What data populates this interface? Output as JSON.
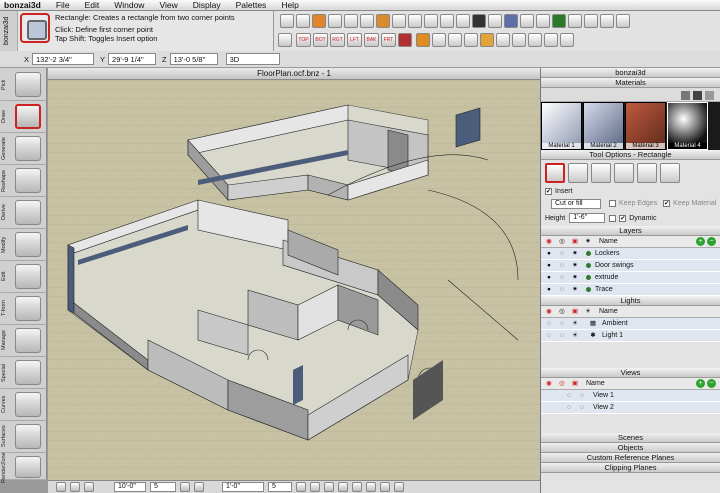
{
  "menu": {
    "app": "bonzai3d",
    "items": [
      "File",
      "Edit",
      "Window",
      "View",
      "Display",
      "Palettes",
      "Help"
    ]
  },
  "hint": {
    "side_label": "bonzai3d",
    "line1": "Rectangle:  Creates a rectangle from two corner points",
    "line2": "Click: Define first corner point",
    "line3": "Tap Shift: Toggles Insert option"
  },
  "coords": {
    "x_label": "X",
    "x": "132'-2 3/4\"",
    "y_label": "Y",
    "y": "29'-9 1/4\"",
    "z_label": "Z",
    "z": "13'-0 5/8\"",
    "mode": "3D"
  },
  "view_buttons": [
    "TOP",
    "BOT",
    "RGT",
    "LFT",
    "BAK",
    "FRT"
  ],
  "left_tools": [
    "Pick",
    "Draw",
    "Generate",
    "Reshape",
    "Derive",
    "Modify",
    "Edit",
    "T-form",
    "Manage",
    "Special",
    "Curves",
    "Surfaces",
    "RenderZone"
  ],
  "viewport": {
    "title": "FloorPlan.ocf.bnz - 1"
  },
  "bottom": {
    "grid": "10'-0\"",
    "snap": "5",
    "dist": "1'-0\"",
    "angle": "5"
  },
  "panel": {
    "title": "bonzai3d",
    "materials_header": "Materials",
    "materials": [
      "Material 1",
      "Material 2",
      "Material 3",
      "Material 4"
    ],
    "tool_options_header": "Tool Options - Rectangle",
    "insert_label": "Insert",
    "cut_fill": "Cut or fill",
    "keep_edges": "Keep Edges",
    "keep_material": "Keep Material",
    "height_label": "Height",
    "height_value": "1'-6\"",
    "dynamic": "Dynamic",
    "layers_header": "Layers",
    "layers_name_col": "Name",
    "layers": [
      "Lockers",
      "Door swings",
      "extrude",
      "Trace"
    ],
    "lights_header": "Lights",
    "lights_name_col": "Name",
    "lights": [
      "Ambient",
      "Light 1"
    ],
    "views_header": "Views",
    "views_name_col": "Name",
    "views": [
      "View 1",
      "View 2"
    ],
    "collapsed": [
      "Scenes",
      "Objects",
      "Custom Reference Planes",
      "Clipping Planes"
    ]
  },
  "colors": {
    "accent": "#c22222",
    "floor": "#c7c2a4",
    "wall_top": "#e6e6e6",
    "wall_side": "#8b8b8b",
    "glass": "#4b5d7a"
  },
  "icons": {
    "add": "plus-icon",
    "layer": "eye-icon",
    "lock": "lock-icon"
  }
}
